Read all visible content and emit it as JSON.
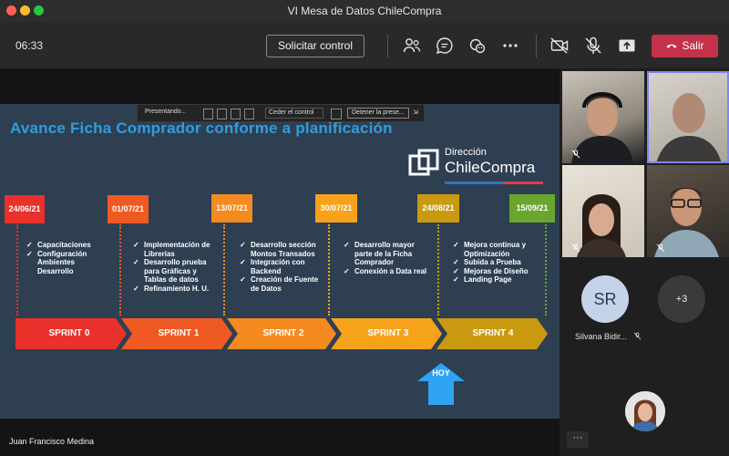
{
  "window": {
    "title": "VI Mesa de Datos ChileCompra"
  },
  "toolbar": {
    "timer": "06:33",
    "request_control": "Solicitar control",
    "leave": "Salir",
    "icons": [
      "people-icon",
      "chat-icon",
      "reactions-icon",
      "more-icon",
      "camera-off-icon",
      "mic-off-icon",
      "share-icon",
      "phone-icon"
    ]
  },
  "presenting_bar": {
    "status": "Presentando...",
    "give_control": "Ceder el control",
    "stop": "Detener la prese..."
  },
  "slide": {
    "title": "Avance Ficha Comprador conforme a planificación",
    "logo": {
      "line1": "Dirección",
      "line2": "ChileCompra"
    },
    "milestones": [
      {
        "date": "24/06/21",
        "color": "#e8312a",
        "sprint": "SPRINT 0",
        "items": [
          "Capacitaciones",
          "Configuración Ambientes Desarrollo"
        ]
      },
      {
        "date": "01/07/21",
        "color": "#ef5a22",
        "sprint": "SPRINT 1",
        "items": [
          "Implementación de Librerías",
          "Desarrollo prueba para Gráficas y Tablas de datos",
          "Refinamiento H. U."
        ]
      },
      {
        "date": "13/07/21",
        "color": "#f58a1f",
        "sprint": "SPRINT 2",
        "items": [
          "Desarrollo sección Montos Transados",
          "Integración con Backend",
          "Creación de Fuente de Datos"
        ]
      },
      {
        "date": "30/07/21",
        "color": "#f7a21b",
        "sprint": "SPRINT 3",
        "items": [
          "Desarrollo mayor parte de la Ficha Comprador",
          "Conexión a Data real"
        ]
      },
      {
        "date": "24/08/21",
        "color": "#c99a10",
        "sprint": "SPRINT 4",
        "items": [
          "Mejora continua y Optimización",
          "Subida a Prueba",
          "Mejoras de Diseño",
          "Landing Page"
        ]
      },
      {
        "date": "15/09/21",
        "color": "#6aa52e",
        "sprint": "",
        "items": []
      }
    ],
    "today_label": "HOY"
  },
  "presenter": {
    "name": "Juan Francisco Medina"
  },
  "participants": {
    "initials": "SR",
    "name": "Silvana Bidir...",
    "overflow": "+3",
    "more": "···"
  },
  "colors": {
    "leave": "#c4314b",
    "title": "#2f9ee0",
    "slide_bg": "#2e3f52",
    "accent_outline": "#7f85f5"
  }
}
